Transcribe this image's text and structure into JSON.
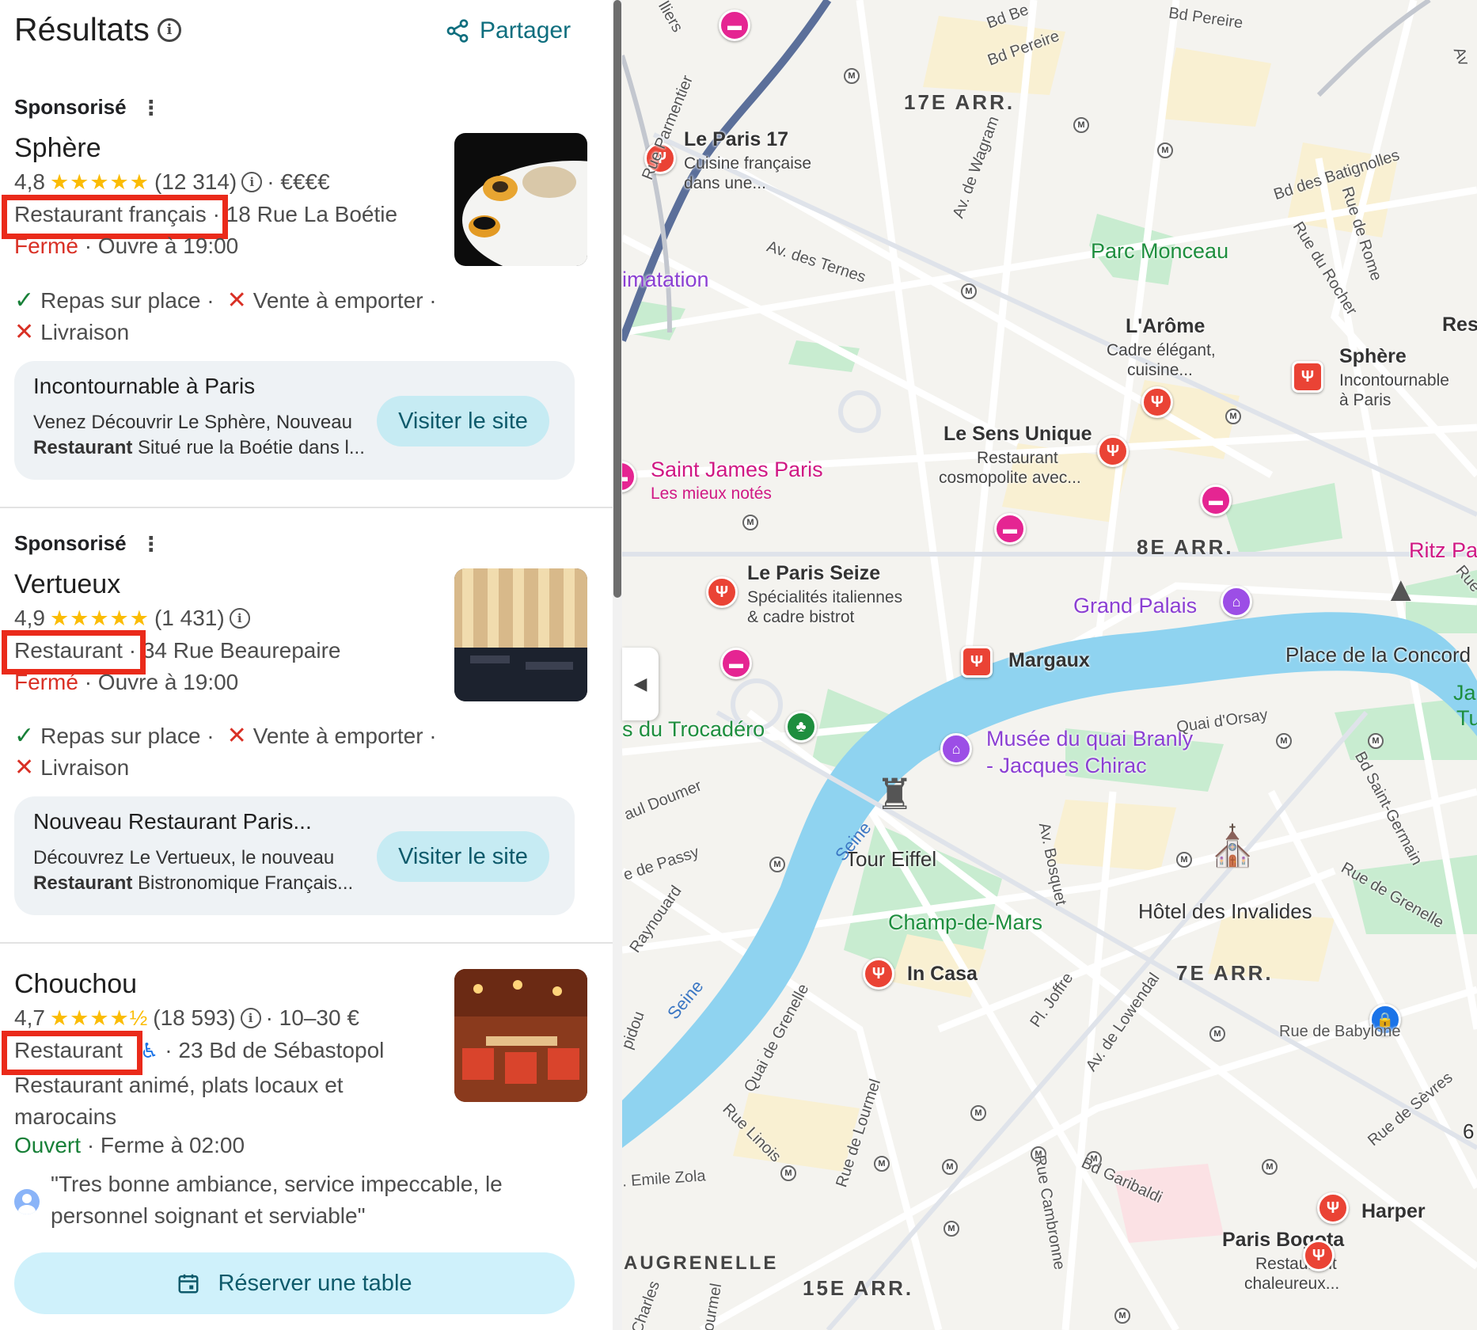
{
  "header": {
    "title": "Résultats",
    "share_label": "Partager"
  },
  "results": [
    {
      "sponsored_label": "Sponsorisé",
      "name": "Sphère",
      "rating": "4,8",
      "stars": "★★★★★",
      "reviews": "(12 314)",
      "price": "· €€€€",
      "category": "Restaurant français",
      "address": "· 18 Rue La Boétie",
      "status": "Fermé",
      "hours": "· Ouvre à 19:00",
      "services": [
        "Repas sur place ·",
        "Vente à emporter ·",
        "Livraison"
      ],
      "ad_title": "Incontournable à Paris",
      "ad_desc_1": "Venez Découvrir Le Sphère, Nouveau",
      "ad_desc_bold": "Restaurant",
      "ad_desc_2": " Situé rue la Boétie dans l...",
      "visit_label": "Visiter le site"
    },
    {
      "sponsored_label": "Sponsorisé",
      "name": "Vertueux",
      "rating": "4,9",
      "stars": "★★★★★",
      "reviews": "(1 431)",
      "category": "Restaurant",
      "address": "· 34 Rue Beaurepaire",
      "status": "Fermé",
      "hours": "· Ouvre à 19:00",
      "services": [
        "Repas sur place ·",
        "Vente à emporter ·",
        "Livraison"
      ],
      "ad_title": "Nouveau Restaurant Paris...",
      "ad_desc_1": "Découvrez Le Vertueux, le nouveau",
      "ad_desc_bold": "Restaurant",
      "ad_desc_2": " Bistronomique Français...",
      "visit_label": "Visiter le site"
    },
    {
      "name": "Chouchou",
      "rating": "4,7",
      "stars": "★★★★½",
      "reviews": "(18 593)",
      "price": "· 10–30 €",
      "category": "Restaurant",
      "address": "· 23 Bd de Sébastopol",
      "description": "Restaurant animé, plats locaux et marocains",
      "status": "Ouvert",
      "hours": "· Ferme à 02:00",
      "review": "\"Tres bonne ambiance, service impeccable, le personnel soignant et serviable\"",
      "reserve_label": "Réserver une table"
    }
  ],
  "map": {
    "districts": [
      "17E ARR.",
      "8E ARR.",
      "7E ARR.",
      "15E ARR."
    ],
    "poi": {
      "le_paris_17": {
        "name": "Le Paris 17",
        "sub1": "Cuisine française",
        "sub2": "dans une..."
      },
      "larome": {
        "name": "L'Arôme",
        "sub1": "Cadre élégant,",
        "sub2": "cuisine..."
      },
      "sphere": {
        "name": "Sphère",
        "sub1": "Incontournable",
        "sub2": "à Paris"
      },
      "sens_unique": {
        "name": "Le Sens Unique",
        "sub1": "Restaurant",
        "sub2": "cosmopolite avec..."
      },
      "paris_seize": {
        "name": "Le Paris Seize",
        "sub1": "Spécialités italiennes",
        "sub2": "& cadre bistrot"
      },
      "margaux": {
        "name": "Margaux"
      },
      "in_casa": {
        "name": "In Casa"
      },
      "harper": {
        "name": "Harper"
      },
      "paris_bogota": {
        "name": "Paris Bogota",
        "sub1": "Restaurant",
        "sub2": "chaleureux..."
      },
      "res": {
        "name": "Res"
      }
    },
    "places": {
      "parc_monceau": "Parc Monceau",
      "saint_james": "Saint James Paris",
      "saint_james_sub": "Les mieux notés",
      "grand_palais": "Grand Palais",
      "ritz": "Ritz Pa",
      "concorde": "Place de la Concord",
      "trocadero": "s du Trocadéro",
      "quai_branly_1": "Musée du quai Branly",
      "quai_branly_2": "- Jacques Chirac",
      "tour_eiffel": "Tour Eiffel",
      "champ_de_mars": "Champ-de-Mars",
      "invalides": "Hôtel des Invalides",
      "imatation": "imatation",
      "augrenelle": "AUGRENELLE",
      "ja": "Ja",
      "tu": "Tu",
      "six": "6"
    },
    "streets": {
      "bd_pereire_1": "Bd Pereire",
      "bd_pereire_2": "Bd Pereire",
      "bd_b": "Bd Be",
      "rue_parmentier": "Rue Parmentier",
      "av_wagram": "Av. de Wagram",
      "av_ternes": "Av. des Ternes",
      "bd_batignolles": "Bd des Batignolles",
      "rue_rome": "Rue de Rome",
      "rue_rocher": "Rue du Rocher",
      "quai_orsay": "Quai d'Orsay",
      "bd_st_germain": "Bd Saint-Germain",
      "rue_grenelle": "Rue de Grenelle",
      "rue_babylone": "Rue de Babylone",
      "rue_sevres": "Rue de Sèvres",
      "av_lowendal": "Av. de Lowendal",
      "pl_joffre": "Pl. Joffre",
      "av_bosquet": "Av. Bosquet",
      "bd_garibaldi": "Bd Garibaldi",
      "rue_cambronne": "Rue Cambronne",
      "rue_lourmel": "Rue de Lourmel",
      "rue_linois": "Rue Linois",
      "quai_grenelle": "Quai de Grenelle",
      "emile_zola": ". Emile Zola",
      "paul_doumer": "aul Doumer",
      "passy": "e de Passy",
      "raynouard": "Raynouard",
      "seine_1": "Seine",
      "seine_2": "Seine",
      "pidou": "pidou",
      "charles": "Charles",
      "ourmel": "ourmel",
      "rue_r": "Rue",
      "lliers": "lliers",
      "av": "Av"
    }
  }
}
